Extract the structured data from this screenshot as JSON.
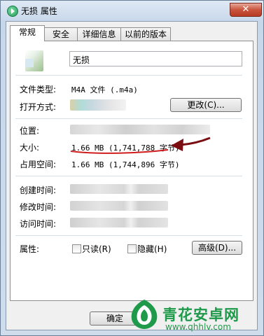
{
  "window": {
    "title": "无损 属性",
    "close_label": "✕"
  },
  "tabs": [
    {
      "label": "常规",
      "active": true
    },
    {
      "label": "安全",
      "active": false
    },
    {
      "label": "详细信息",
      "active": false
    },
    {
      "label": "以前的版本",
      "active": false
    }
  ],
  "general": {
    "file_name": "无损",
    "file_type_label": "文件类型:",
    "file_type_value": "M4A 文件 (.m4a)",
    "open_with_label": "打开方式:",
    "change_button": "更改(C)...",
    "location_label": "位置:",
    "size_label": "大小:",
    "size_value": "1.66 MB (1,741,788 字节)",
    "size_on_disk_label": "占用空间:",
    "size_on_disk_value": "1.66 MB (1,744,896 字节)",
    "created_label": "创建时间:",
    "modified_label": "修改时间:",
    "accessed_label": "访问时间:",
    "attributes_label": "属性:",
    "readonly_label": "只读(R)",
    "hidden_label": "隐藏(H)",
    "advanced_button": "高级(D)..."
  },
  "footer": {
    "ok_button": "确定"
  },
  "watermark": {
    "brand": "青花安卓网",
    "url": "www.qhhlv.com"
  },
  "colors": {
    "annotation_red": "#d01c1c",
    "arrow_darkred": "#7a0d12",
    "watermark_green": "#1e9a4a"
  }
}
